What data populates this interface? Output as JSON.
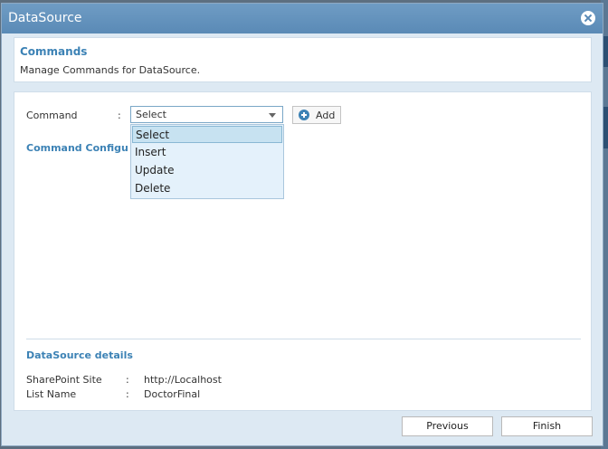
{
  "dialog": {
    "title": "DataSource",
    "close_icon": "close-icon"
  },
  "commands_section": {
    "heading": "Commands",
    "description": "Manage Commands for DataSource."
  },
  "command_row": {
    "label": "Command",
    "colon": ":",
    "selected_value": "Select",
    "add_label": "Add",
    "add_icon": "plus-circle-icon"
  },
  "dropdown": {
    "options": [
      "Select",
      "Insert",
      "Update",
      "Delete"
    ],
    "selected_index": 0
  },
  "configuration": {
    "heading": "Command Configu"
  },
  "datasource_details": {
    "heading": "DataSource details",
    "rows": [
      {
        "key": "SharePoint Site",
        "colon": ":",
        "value": "http://Localhost"
      },
      {
        "key": "List Name",
        "colon": ":",
        "value": "DoctorFinal"
      }
    ]
  },
  "footer": {
    "previous_label": "Previous",
    "finish_label": "Finish"
  },
  "colors": {
    "titlebar": "#5a8ab6",
    "heading": "#3c82b5",
    "dialog_bg": "#dde9f3"
  }
}
